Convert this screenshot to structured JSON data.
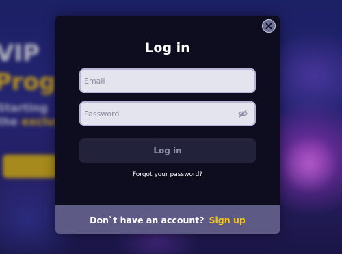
{
  "background": {
    "headline_1": "VIP",
    "headline_2": "Prog",
    "line_1": "Starting ",
    "line_2_prefix": "the ",
    "line_2_highlight": "exclusi"
  },
  "modal": {
    "title": "Log in",
    "close_icon": "close-icon",
    "email": {
      "placeholder": "Email",
      "value": ""
    },
    "password": {
      "placeholder": "Password",
      "value": "",
      "toggle_icon": "eye-off-icon"
    },
    "login_button_label": "Log in",
    "forgot_password_label": "Forgot your password?",
    "footer": {
      "prompt": "Don`t have an account?",
      "signup_label": "Sign up"
    }
  },
  "colors": {
    "modal_bg": "#0d0d1f",
    "footer_bg": "#5d5a86",
    "accent": "#f5c518",
    "field_bg": "#e4e4ef",
    "button_bg": "#22223a"
  }
}
